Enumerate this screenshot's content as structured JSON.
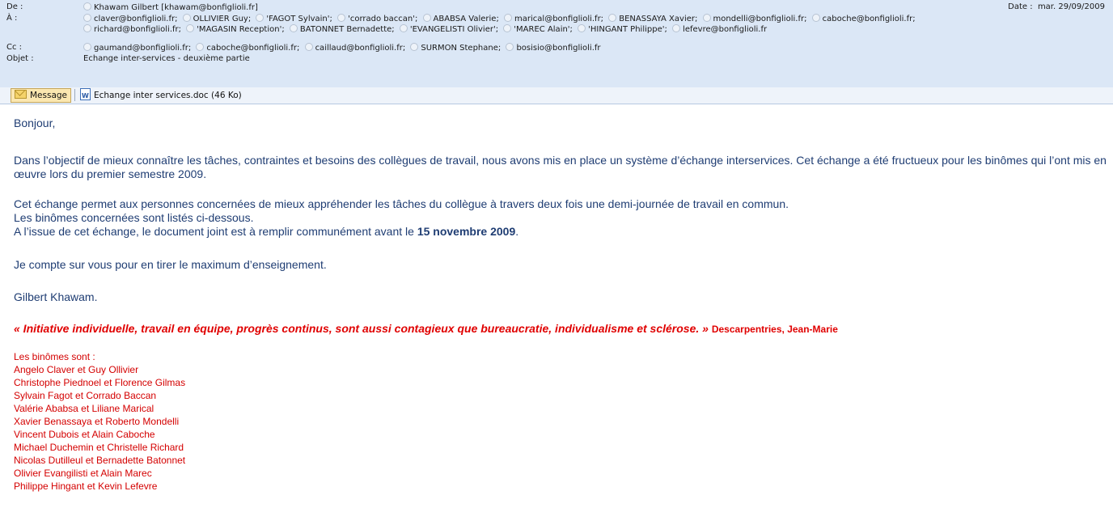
{
  "header": {
    "from_label": "De :",
    "from": "Khawam Gilbert [khawam@bonfiglioli.fr]",
    "date_label": "Date :",
    "date_value": "mar. 29/09/2009",
    "to_label": "À :",
    "to": [
      "claver@bonfiglioli.fr;",
      "OLLIVIER Guy;",
      "'FAGOT Sylvain';",
      "'corrado baccan';",
      "ABABSA Valerie;",
      "marical@bonfiglioli.fr;",
      "BENASSAYA Xavier;",
      "mondelli@bonfiglioli.fr;",
      "caboche@bonfiglioli.fr;",
      "richard@bonfiglioli.fr;",
      "'MAGASIN Reception';",
      "BATONNET Bernadette;",
      "'EVANGELISTI Olivier';",
      "'MAREC Alain';",
      "'HINGANT Philippe';",
      "lefevre@bonfiglioli.fr"
    ],
    "cc_label": "Cc :",
    "cc": [
      "gaumand@bonfiglioli.fr;",
      "caboche@bonfiglioli.fr;",
      "caillaud@bonfiglioli.fr;",
      "SURMON Stephane;",
      "bosisio@bonfiglioli.fr"
    ],
    "subject_label": "Objet :",
    "subject": "Echange inter-services - deuxième partie"
  },
  "toolbar": {
    "message_label": "Message",
    "attachment_label": "Echange inter services.doc (46 Ko)"
  },
  "body": {
    "greeting": "Bonjour,",
    "p1": "Dans l’objectif de mieux connaître les tâches, contraintes et besoins des collègues de travail, nous avons mis en place un système d’échange interservices. Cet échange a été fructueux pour les binômes qui l’ont mis en œuvre lors du premier semestre 2009.",
    "p2_line1": "Cet échange permet aux personnes concernées de mieux appréhender les tâches du collègue à travers deux fois une demi-journée de travail en commun.",
    "p2_line2": "Les binômes concernées sont listés ci-dessous.",
    "p2_line3_pre": "A l’issue de cet échange, le document joint est à remplir communément avant le ",
    "p2_deadline": "15 novembre 2009",
    "p2_line3_post": ".",
    "p3": "Je compte sur vous pour en tirer le maximum d’enseignement.",
    "signature": "Gilbert Khawam.",
    "quote": "« Initiative individuelle, travail en équipe, progrès continus, sont aussi contagieux que bureaucratie, individualisme et sclérose. »",
    "quote_author": "Descarpentries, Jean-Marie",
    "pairs_title": "Les binômes sont :",
    "pairs": [
      "Angelo Claver et Guy Ollivier",
      "Christophe Piednoel et Florence Gilmas",
      "Sylvain Fagot et Corrado Baccan",
      "Valérie Ababsa et Liliane Marical",
      "Xavier Benassaya et Roberto Mondelli",
      "Vincent Dubois et Alain Caboche",
      "Michael Duchemin et Christelle Richard",
      "Nicolas Dutilleul et Bernadette Batonnet",
      "Olivier Evangilisti et Alain Marec",
      "Philippe Hingant et Kevin Lefevre"
    ]
  },
  "colors": {
    "header_bg": "#dbe7f6",
    "body_text": "#1f3d73",
    "quote_red": "#e00000",
    "list_red": "#d40000"
  }
}
